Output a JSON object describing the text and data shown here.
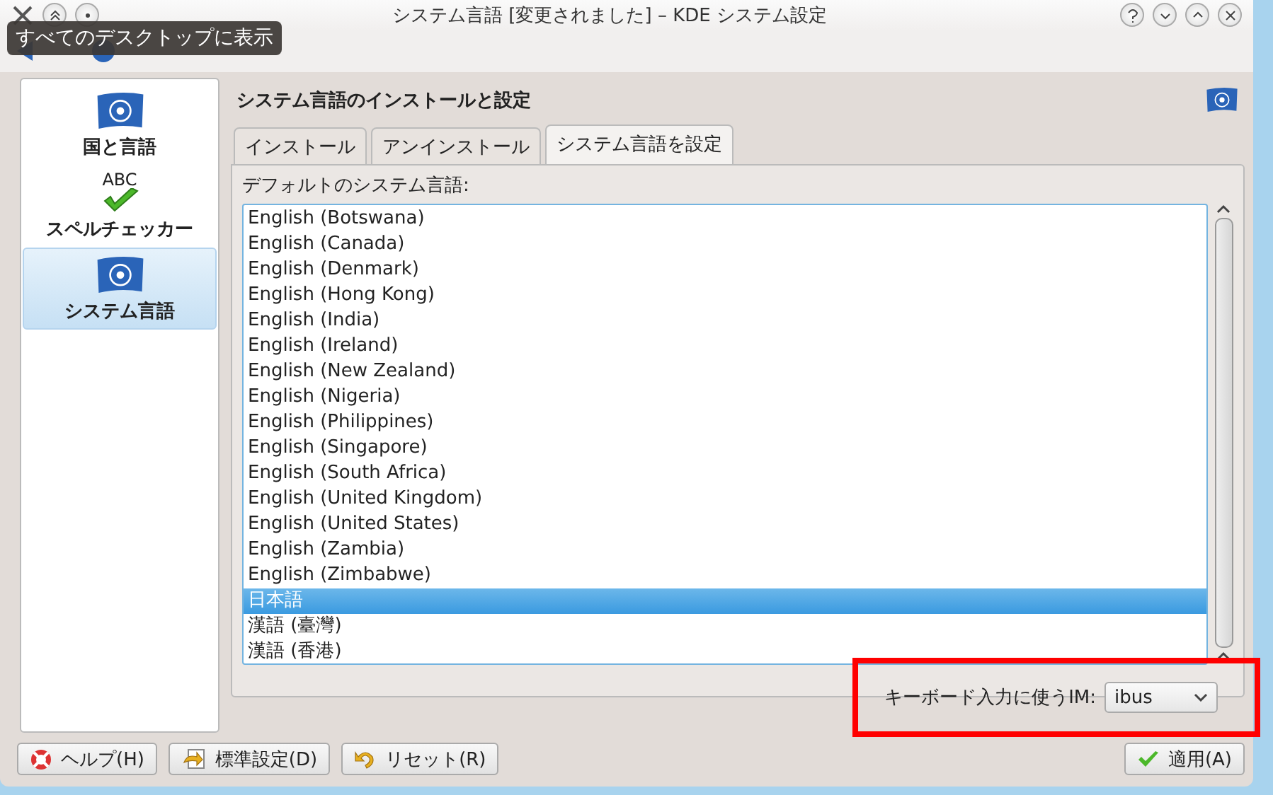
{
  "window": {
    "title": "システム言語 [変更されました] – KDE システム設定"
  },
  "tooltip": "すべてのデスクトップに表示",
  "sidebar": {
    "items": [
      {
        "label": "国と言語",
        "kind": "flag",
        "selected": false
      },
      {
        "label": "スペルチェッカー",
        "kind": "spell",
        "icon_text": "ABC",
        "selected": false
      },
      {
        "label": "システム言語",
        "kind": "flag",
        "selected": true
      }
    ]
  },
  "header": "システム言語のインストールと設定",
  "tabs": [
    {
      "label": "インストール",
      "selected": false
    },
    {
      "label": "アンインストール",
      "selected": false
    },
    {
      "label": "システム言語を設定",
      "selected": true
    }
  ],
  "list_label": "デフォルトのシステム言語:",
  "languages": [
    {
      "label": "English (Botswana)",
      "selected": false
    },
    {
      "label": "English (Canada)",
      "selected": false
    },
    {
      "label": "English (Denmark)",
      "selected": false
    },
    {
      "label": "English (Hong Kong)",
      "selected": false
    },
    {
      "label": "English (India)",
      "selected": false
    },
    {
      "label": "English (Ireland)",
      "selected": false
    },
    {
      "label": "English (New Zealand)",
      "selected": false
    },
    {
      "label": "English (Nigeria)",
      "selected": false
    },
    {
      "label": "English (Philippines)",
      "selected": false
    },
    {
      "label": "English (Singapore)",
      "selected": false
    },
    {
      "label": "English (South Africa)",
      "selected": false
    },
    {
      "label": "English (United Kingdom)",
      "selected": false
    },
    {
      "label": "English (United States)",
      "selected": false
    },
    {
      "label": "English (Zambia)",
      "selected": false
    },
    {
      "label": "English (Zimbabwe)",
      "selected": false
    },
    {
      "label": "日本語",
      "selected": true
    },
    {
      "label": "漢語 (臺灣)",
      "selected": false
    },
    {
      "label": "漢語 (香港)",
      "selected": false
    }
  ],
  "im": {
    "label": "キーボード入力に使うIM:",
    "value": "ibus"
  },
  "buttons": [
    {
      "label": "ヘルプ(H)",
      "kind": "help"
    },
    {
      "label": "標準設定(D)",
      "kind": "defaults"
    },
    {
      "label": "リセット(R)",
      "kind": "reset"
    },
    {
      "label": "適用(A)",
      "kind": "apply"
    }
  ]
}
